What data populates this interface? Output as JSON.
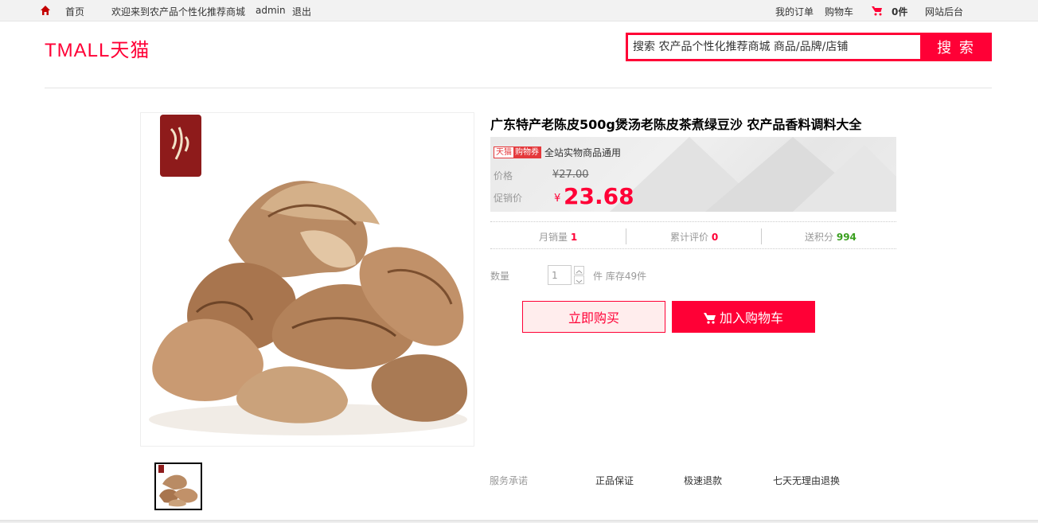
{
  "topbar": {
    "home_label": "首页",
    "welcome": "欢迎来到农产品个性化推荐商城",
    "username": "admin",
    "logout": "退出",
    "my_orders": "我的订单",
    "cart": "购物车",
    "cart_count": "0件",
    "admin_backend": "网站后台"
  },
  "header": {
    "logo_text": "TMALL天猫",
    "search_placeholder": "搜索 农产品个性化推荐商城 商品/品牌/店铺",
    "search_button": "搜 索"
  },
  "product": {
    "title": "广东特产老陈皮500g煲汤老陈皮茶煮绿豆沙 农产品香料调料大全",
    "coupon_badge_left": "天猫",
    "coupon_badge_right": "购物券",
    "coupon_text": "全站实物商品通用",
    "price_label": "价格",
    "original_price": "¥27.00",
    "promo_label": "促销价",
    "currency": "¥",
    "promo_price": "23.68",
    "monthly_sales_label": "月销量",
    "monthly_sales": "1",
    "reviews_label": "累计评价",
    "reviews": "0",
    "points_label": "送积分",
    "points": "994",
    "quantity_label": "数量",
    "quantity_value": "1",
    "stock_text": "件 库存49件",
    "buy_now": "立即购买",
    "add_to_cart": "加入购物车"
  },
  "services": {
    "label": "服务承诺",
    "items": [
      "正品保证",
      "极速退款",
      "七天无理由退换"
    ]
  },
  "colors": {
    "accent": "#ff0036",
    "points_green": "#3a9f1f",
    "topbar_bg": "#f2f2f2"
  }
}
